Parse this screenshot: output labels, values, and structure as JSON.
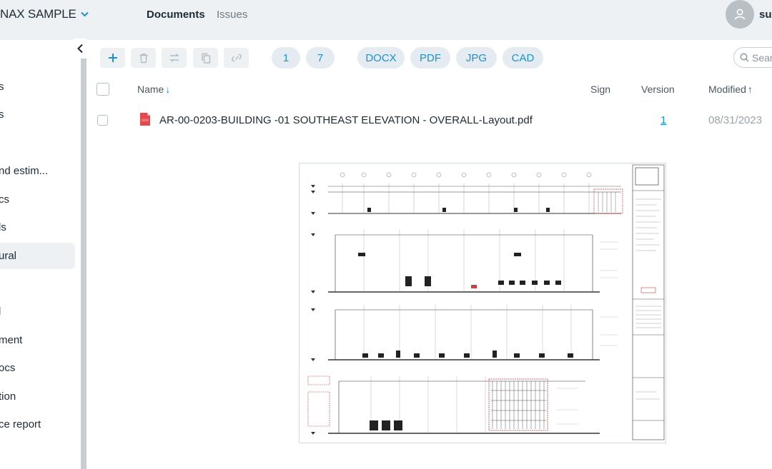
{
  "header": {
    "project_name": "NAX SAMPLE",
    "nav": [
      {
        "label": "Documents",
        "active": true
      },
      {
        "label": "Issues",
        "active": false
      }
    ],
    "user_partial": "su",
    "icons": {
      "project": "chevron-down-icon",
      "avatar": "user-icon"
    }
  },
  "sidebar": {
    "items": [
      {
        "label": "s",
        "active": false
      },
      {
        "label": "s",
        "active": false
      },
      {
        "label": "nd estim...",
        "active": false
      },
      {
        "label": "cs",
        "active": false
      },
      {
        "label": "ls",
        "active": false
      },
      {
        "label": "ural",
        "active": true
      },
      {
        "label": "l",
        "active": false
      },
      {
        "label": "ment",
        "active": false
      },
      {
        "label": "ocs",
        "active": false
      },
      {
        "label": "tion",
        "active": false
      },
      {
        "label": "ce report",
        "active": false
      }
    ]
  },
  "toolbar": {
    "buttons": [
      {
        "name": "add",
        "icon": "plus-icon"
      },
      {
        "name": "delete",
        "icon": "trash-icon"
      },
      {
        "name": "move",
        "icon": "swap-icon"
      },
      {
        "name": "copy",
        "icon": "copy-icon"
      },
      {
        "name": "link",
        "icon": "link-icon"
      }
    ],
    "pills": [
      "1",
      "7",
      "DOCX",
      "PDF",
      "JPG",
      "CAD"
    ],
    "search_placeholder": "Search"
  },
  "table": {
    "columns": {
      "name": "Name",
      "sign": "Sign",
      "version": "Version",
      "modified": "Modified"
    },
    "rows": [
      {
        "name": "AR-00-0203-BUILDING -01 SOUTHEAST ELEVATION - OVERALL-Layout.pdf",
        "sign": "",
        "version": "1",
        "modified": "08/31/2023",
        "file_icon": "pdf-file-icon"
      }
    ]
  },
  "colors": {
    "accent": "#1a91d1",
    "topbar": "#eef1f3",
    "pdf": "#e5484d",
    "markup": "#d93b3b"
  }
}
